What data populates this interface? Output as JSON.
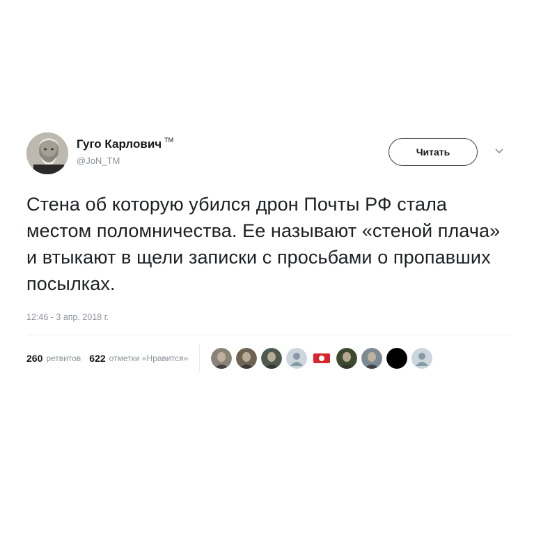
{
  "user": {
    "display_name": "Гуго Карлович",
    "tm": "TM",
    "handle": "@JoN_TM"
  },
  "follow_label": "Читать",
  "tweet_text": "Стена об которую убился дрон Почты РФ стала местом поломничества. Ее называют «стеной плача» и втыкают в щели записки с просьбами о пропавших посылках.",
  "timestamp": "12:46 - 3 апр. 2018 г.",
  "stats": {
    "retweets_count": "260",
    "retweets_label": "ретвитов",
    "likes_count": "622",
    "likes_label": "отметки «Нравится»"
  },
  "likers": [
    {
      "kind": "photo",
      "color": "#8a8478"
    },
    {
      "kind": "photo",
      "color": "#6e6253"
    },
    {
      "kind": "photo",
      "color": "#4f5a4f"
    },
    {
      "kind": "default",
      "color": "#ccd6dd"
    },
    {
      "kind": "red-badge",
      "color": "#d8252b"
    },
    {
      "kind": "photo",
      "color": "#3b4a2f"
    },
    {
      "kind": "photo",
      "color": "#7c8a94"
    },
    {
      "kind": "solid",
      "color": "#000000"
    },
    {
      "kind": "default",
      "color": "#ccd6dd"
    }
  ],
  "colors": {
    "text": "#14171a",
    "secondary": "#8a9199",
    "divider": "#e6ecf0"
  }
}
